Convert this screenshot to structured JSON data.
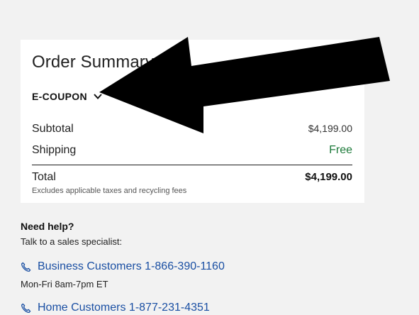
{
  "order_summary": {
    "title": "Order Summary",
    "ecoupon_label": "E-COUPON",
    "subtotal_label": "Subtotal",
    "subtotal_value": "$4,199.00",
    "shipping_label": "Shipping",
    "shipping_value": "Free",
    "total_label": "Total",
    "total_value": "$4,199.00",
    "note": "Excludes applicable taxes and recycling fees"
  },
  "help": {
    "title": "Need help?",
    "subtitle": "Talk to a sales specialist:",
    "business_link": "Business Customers 1-866-390-1160",
    "business_hours": "Mon-Fri 8am-7pm ET",
    "home_link": "Home Customers 1-877-231-4351"
  },
  "icons": {
    "ecoupon_toggle": "chevron-down-icon",
    "phone": "phone-icon",
    "annotation": "arrow-left-icon"
  },
  "colors": {
    "page_bg": "#f2f2f2",
    "card_bg": "#ffffff",
    "link": "#1a4fa3",
    "free": "#1d7a3a",
    "annotation": "#000000"
  }
}
